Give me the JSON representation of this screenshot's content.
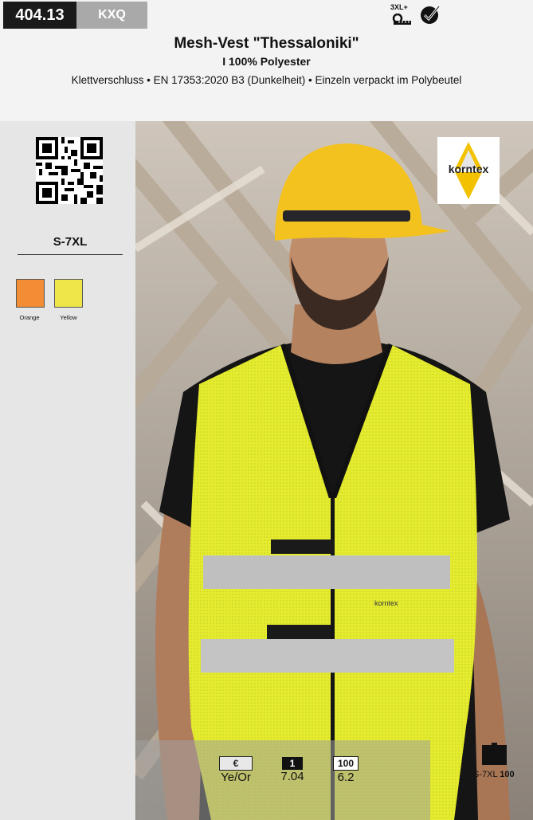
{
  "top_bar": {
    "article_number": "404.13",
    "variant_code": "KXQ",
    "size_badge": "3XL+"
  },
  "header": {
    "title": "Mesh-Vest \"Thessaloniki\"",
    "subtitle": "I 100% Polyester",
    "features": "Klettverschluss • EN 17353:2020 B3 (Dunkelheit) • Einzeln verpackt im Polybeutel"
  },
  "sidebar": {
    "size_range": "S-7XL",
    "colors": [
      {
        "name": "Orange",
        "hex": "#f28d35"
      },
      {
        "name": "Yellow",
        "hex": "#efe74a"
      }
    ]
  },
  "logo": {
    "text": "korntex"
  },
  "vest_label": "korntex",
  "price_table": {
    "currency_header": "€",
    "qty_header_1": "1",
    "qty_header_2": "100",
    "row_label": "Ye/Or",
    "price_1": "7.04",
    "price_100": "6.2"
  },
  "packaging": {
    "sizes": "S-7XL",
    "quantity": "100"
  }
}
